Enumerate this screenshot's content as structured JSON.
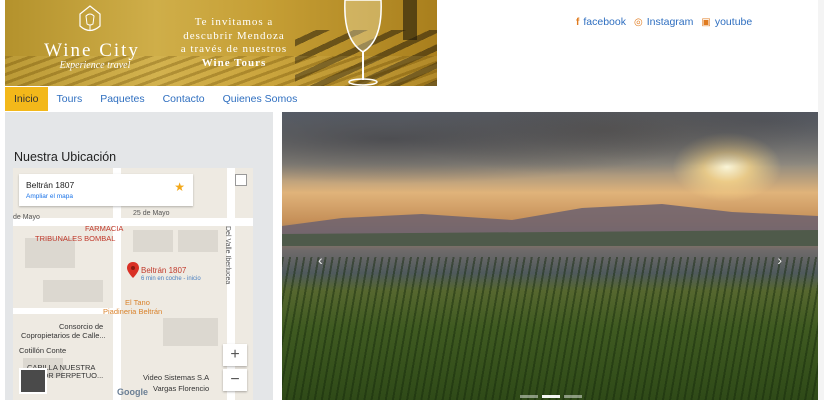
{
  "header": {
    "brand": "Wine City",
    "tagline": "Experience travel",
    "promo_lines": [
      "Te invitamos a",
      "descubrir Mendoza",
      "a través de nuestros"
    ],
    "promo_bold": "Wine Tours"
  },
  "social": [
    {
      "icon": "facebook-icon",
      "glyph": "f",
      "label": "facebook"
    },
    {
      "icon": "instagram-icon",
      "glyph": "◎",
      "label": "Instagram"
    },
    {
      "icon": "youtube-icon",
      "glyph": "▣",
      "label": "youtube"
    }
  ],
  "nav": [
    {
      "label": "Inicio",
      "active": true
    },
    {
      "label": "Tours"
    },
    {
      "label": "Paquetes"
    },
    {
      "label": "Contacto"
    },
    {
      "label": "Quienes Somos"
    }
  ],
  "location": {
    "title": "Nuestra Ubicación",
    "map": {
      "address": "Beltrán 1807",
      "expand_link": "Ampliar el mapa",
      "pin_label": "Beltrán 1807",
      "pin_sub": "6 min en coche - inicio",
      "streets": [
        "25 de Mayo",
        "de Mayo",
        "Del Valle Iberlucea"
      ],
      "places": [
        {
          "name": "FARMACIA",
          "style": "red"
        },
        {
          "name": "TRIBUNALES BOMBAL",
          "style": "red"
        },
        {
          "name": "El Tano",
          "style": "orange"
        },
        {
          "name": "Piadineria Beltrán",
          "style": "orange"
        },
        {
          "name": "Consorcio de",
          "style": "dark"
        },
        {
          "name": "Copropietarios de Calle...",
          "style": "dark"
        },
        {
          "name": "Cotillón Conte",
          "style": "dark"
        },
        {
          "name": "CAPILLA NUESTRA",
          "style": "dark"
        },
        {
          "name": "SEÑOR PERPETUO...",
          "style": "dark"
        },
        {
          "name": "Video Sistemas S.A",
          "style": "dark"
        },
        {
          "name": "Vargas Florencio",
          "style": "dark"
        }
      ],
      "zoom_in": "+",
      "zoom_out": "−",
      "logo": "Google"
    }
  },
  "slider": {
    "prev": "‹",
    "next": "›",
    "slide_count": 3,
    "active_slide": 2
  }
}
